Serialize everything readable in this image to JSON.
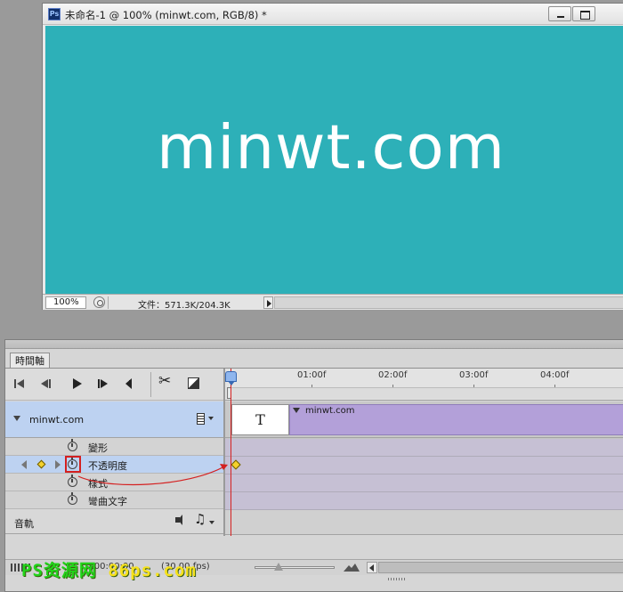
{
  "document": {
    "app_badge": "Ps",
    "title": "未命名-1 @ 100% (minwt.com, RGB/8) *",
    "canvas_text": "minwt.com",
    "canvas_color": "#2db0b8",
    "zoom": "100%",
    "file_size": "文件：571.3K/204.3K"
  },
  "timeline": {
    "tab_label": "時間軸",
    "controls": [
      "first-frame-icon",
      "prev-frame-icon",
      "play-icon",
      "next-frame-icon",
      "mute-icon",
      "scissors-icon",
      "transition-icon"
    ],
    "ruler": [
      {
        "label": "01:00f"
      },
      {
        "label": "02:00f"
      },
      {
        "label": "03:00f"
      },
      {
        "label": "04:00f"
      }
    ],
    "layer": {
      "name": "minwt.com",
      "clip_name": "minwt.com",
      "thumb_glyph": "T"
    },
    "properties": [
      {
        "label": "變形",
        "highlighted": false,
        "has_keyframe": false
      },
      {
        "label": "不透明度",
        "highlighted": true,
        "has_keyframe": true
      },
      {
        "label": "樣式",
        "highlighted": false,
        "has_keyframe": false
      },
      {
        "label": "彎曲文字",
        "highlighted": false,
        "has_keyframe": false
      }
    ],
    "audio_label": "音軌",
    "time_readout": "0:00:00:00",
    "fps": "(30.00 fps)",
    "accent_color": "#d42020",
    "clip_color": "#b3a0d9"
  },
  "watermark": {
    "part1": "PS资源网",
    "part2": "86ps.com"
  }
}
